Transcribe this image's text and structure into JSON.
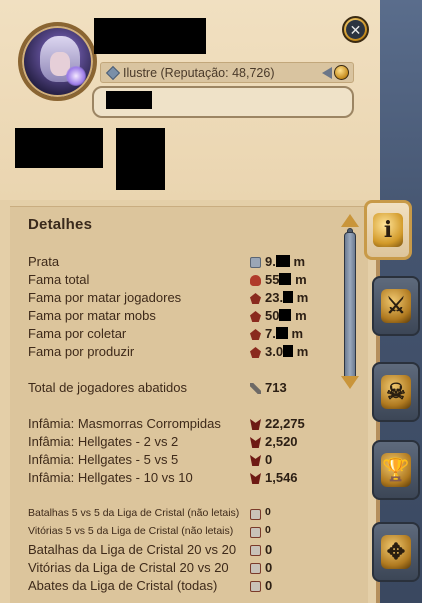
{
  "profile": {
    "reputation_text": "Ilustre (Reputação: 48,726)"
  },
  "details": {
    "title": "Detalhes",
    "rows": [
      {
        "label": "Prata",
        "icon": "silver-icon",
        "value_prefix": "9.",
        "value_suffix": "m"
      },
      {
        "label": "Fama total",
        "icon": "fame-icon",
        "value_prefix": "55",
        "value_suffix": "m"
      },
      {
        "label": "Fama por matar jogadores",
        "icon": "pvp-fame-icon",
        "value_prefix": "23.",
        "value_suffix": "m"
      },
      {
        "label": "Fama por matar mobs",
        "icon": "pve-fame-icon",
        "value_prefix": "50",
        "value_suffix": "m"
      },
      {
        "label": "Fama por coletar",
        "icon": "gathering-fame-icon",
        "value_prefix": "7.",
        "value_suffix": "m"
      },
      {
        "label": "Fama por produzir",
        "icon": "crafting-fame-icon",
        "value_prefix": "3.0",
        "value_suffix": "m"
      },
      {
        "label": "Total de jogadores abatidos",
        "icon": "crossed-swords-icon",
        "value": "713"
      },
      {
        "label": "Infâmia: Masmorras Corrompidas",
        "icon": "infamy-icon",
        "value": "22,275"
      },
      {
        "label": "Infâmia: Hellgates - 2 vs 2",
        "icon": "infamy-icon",
        "value": "2,520"
      },
      {
        "label": "Infâmia: Hellgates - 5 vs 5",
        "icon": "infamy-icon",
        "value": "0"
      },
      {
        "label": "Infâmia: Hellgates - 10 vs 10",
        "icon": "infamy-icon",
        "value": "1,546"
      },
      {
        "label": "Batalhas 5 vs 5 da Liga de Cristal (não letais)",
        "icon": "crystal-league-icon",
        "value": "0"
      },
      {
        "label": "Vitórias 5 vs 5 da Liga de Cristal (não letais)",
        "icon": "crystal-league-icon",
        "value": "0"
      },
      {
        "label": "Batalhas da Liga de Cristal 20 vs 20",
        "icon": "crystal-league-icon",
        "value": "0"
      },
      {
        "label": "Vitórias da Liga de Cristal 20 vs 20",
        "icon": "crystal-league-icon",
        "value": "0"
      },
      {
        "label": "Abates da Liga de Cristal (todas)",
        "icon": "crystal-league-icon",
        "value": "0"
      }
    ]
  },
  "tabs": [
    {
      "name": "info-tab",
      "icon": "info-icon",
      "glyph": "i",
      "active": true
    },
    {
      "name": "combat-tab",
      "icon": "crossed-swords-icon",
      "glyph": "⚔",
      "active": false
    },
    {
      "name": "pvp-tab",
      "icon": "skull-crossbones-icon",
      "glyph": "☠",
      "active": false
    },
    {
      "name": "trophy-tab",
      "icon": "trophy-icon",
      "glyph": "🏆",
      "active": false
    },
    {
      "name": "guild-tab",
      "icon": "guild-crest-icon",
      "glyph": "✥",
      "active": false
    }
  ],
  "colors": {
    "panel_background": "#e4cfa8",
    "details_background": "#dcc59c",
    "accent_gold": "#c89a48",
    "text_dark": "#3e2a1a"
  }
}
